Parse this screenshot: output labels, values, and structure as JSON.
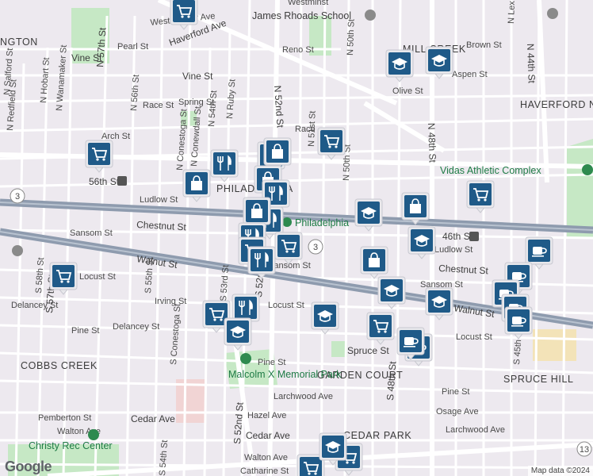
{
  "attribution": {
    "logo": "Google",
    "map_data": "Map data ©2024"
  },
  "neighborhoods": [
    {
      "id": "cobbs-creek",
      "label": "COBBS CREEK"
    },
    {
      "id": "garden-court",
      "label": "GARDEN COURT"
    },
    {
      "id": "spruce-hill",
      "label": "SPRUCE HILL"
    },
    {
      "id": "cedar-park",
      "label": "CEDAR PARK"
    },
    {
      "id": "mill-creek",
      "label": "MILL CREEK"
    },
    {
      "id": "haverford-north",
      "label": "HAVERFORD NORTH"
    },
    {
      "id": "west-philadelphia",
      "label": "PHILADELPHIA"
    },
    {
      "id": "ington",
      "label": "NGTON"
    }
  ],
  "pois": [
    {
      "id": "james-rhoads-school",
      "label": "James Rhoads School"
    },
    {
      "id": "vidas-athletic-complex",
      "label": "Vidas Athletic Complex"
    },
    {
      "id": "malcolm-x-park",
      "label": "Malcolm X Memorial Park"
    },
    {
      "id": "christy-rec-center",
      "label": "Christy Rec Center"
    },
    {
      "id": "philadelphia-poi",
      "label": "Philadelphia"
    }
  ],
  "transit": [
    {
      "id": "56th-st-station",
      "label": "56th St"
    },
    {
      "id": "46th-st-station",
      "label": "46th St"
    }
  ],
  "streets": {
    "westminster": "Westminster Ave",
    "westminst_top": "Westminst",
    "haverford": "Haverford Ave",
    "pearl": "Pearl St",
    "vine": "Vine St",
    "reno": "Reno St",
    "brown": "Brown St",
    "aspen": "Aspen St",
    "olive": "Olive St",
    "spring": "Spring St",
    "race_w": "Race St",
    "race_e": "Race",
    "arch": "Arch St",
    "ludlow_w": "Ludlow St",
    "ludlow_e": "Ludlow St",
    "chestnut_w": "Chestnut St",
    "chestnut_e": "Chestnut St",
    "sansom_w": "Sansom St",
    "sansom_c": "Sansom St",
    "sansom_e": "Sansom St",
    "walnut": "Walnut St",
    "walnut_e": "Walnut St",
    "locust_w": "Locust St",
    "locust_c": "Locust St",
    "locust_e": "Locust St",
    "irving": "Irving St",
    "delancey_w": "Delancey St",
    "delancey_c": "Delancey St",
    "pine_w": "Pine St",
    "pine_c": "Pine St",
    "pine_e": "Pine St",
    "spruce": "Spruce St",
    "larchwood": "Larchwood Ave",
    "larchwood_e": "Larchwood Ave",
    "osage": "Osage Ave",
    "hazel": "Hazel Ave",
    "cedar_w": "Cedar Ave",
    "cedar_c": "Cedar Ave",
    "pemberton": "Pemberton St",
    "walton_w": "Walton Ave",
    "walton_c": "Walton Ave",
    "catharine": "Catharine St",
    "n52": "N 52nd St",
    "n51": "N 51st St",
    "n50": "N 50th St",
    "n48": "N 48th St",
    "n44": "N 44th St",
    "n45": "N 45th St",
    "n57": "N 57th St",
    "n56": "N 56th St",
    "n54": "N 54th St",
    "n55": "N 55th St",
    "nconestoga": "N Conestoga St",
    "nruby": "N Ruby St",
    "nredfield": "N Redfield St",
    "nhobart": "N Hobart St",
    "nwanamaker": "N Wanamaker St",
    "nsalford": "N Salford St",
    "nlex": "N Lex St",
    "s58": "S 58th St",
    "s57": "S 57th St",
    "s55": "S 55th St",
    "s54": "S 54th St",
    "s53": "S 53rd St",
    "s52": "S 52nd St",
    "s52b": "S 52nd St",
    "s48": "S 48th St",
    "s45": "S 45th St",
    "sconestoga": "S Conestoga St",
    "ncewdall": "N Conewdall St",
    "mint": "Aspen St",
    "route3_a": "3",
    "route3_b": "3",
    "route13": "13"
  },
  "markers": [
    {
      "type": "shopping-cart",
      "id": "m1"
    },
    {
      "type": "school",
      "id": "m2"
    },
    {
      "type": "school",
      "id": "m3"
    },
    {
      "type": "shopping-cart",
      "id": "m4"
    },
    {
      "type": "shopping-cart",
      "id": "m5"
    },
    {
      "type": "restaurant",
      "id": "m6"
    },
    {
      "type": "shopping-bag",
      "id": "m7"
    },
    {
      "type": "shopping-bag",
      "id": "m8"
    },
    {
      "type": "shopping-bag",
      "id": "m9"
    },
    {
      "type": "shopping-bag",
      "id": "m10"
    },
    {
      "type": "restaurant",
      "id": "m11"
    },
    {
      "type": "restaurant",
      "id": "m12"
    },
    {
      "type": "shopping-bag",
      "id": "m13"
    },
    {
      "type": "school",
      "id": "m14"
    },
    {
      "type": "shopping-bag",
      "id": "m15"
    },
    {
      "type": "shopping-cart",
      "id": "m16"
    },
    {
      "type": "school",
      "id": "m17"
    },
    {
      "type": "shopping-bag",
      "id": "m18"
    },
    {
      "type": "shopping-cart",
      "id": "m19"
    },
    {
      "type": "restaurant",
      "id": "m20"
    },
    {
      "type": "shopping-cart",
      "id": "m21"
    },
    {
      "type": "restaurant",
      "id": "m22"
    },
    {
      "type": "shopping-cart",
      "id": "m23"
    },
    {
      "type": "school",
      "id": "m24"
    },
    {
      "type": "restaurant",
      "id": "m25"
    },
    {
      "type": "shopping-cart",
      "id": "m26"
    },
    {
      "type": "school",
      "id": "m27"
    },
    {
      "type": "school",
      "id": "m28"
    },
    {
      "type": "school",
      "id": "m29"
    },
    {
      "type": "shopping-cart",
      "id": "m30"
    },
    {
      "type": "coffee",
      "id": "m31"
    },
    {
      "type": "coffee",
      "id": "m32"
    },
    {
      "type": "coffee",
      "id": "m33"
    },
    {
      "type": "coffee",
      "id": "m34"
    },
    {
      "type": "coffee",
      "id": "m35"
    },
    {
      "type": "coffee",
      "id": "m36"
    },
    {
      "type": "coffee",
      "id": "m37"
    },
    {
      "type": "shopping-cart",
      "id": "m38"
    },
    {
      "type": "shopping-cart",
      "id": "m39"
    },
    {
      "type": "school",
      "id": "m40"
    }
  ],
  "colors": {
    "background": "#ede9ef",
    "road": "#ffffff",
    "highway": "#8e9bae",
    "park": "#c6e8c5",
    "pin": "#1f5a88",
    "park_text": "#1e7b45"
  }
}
